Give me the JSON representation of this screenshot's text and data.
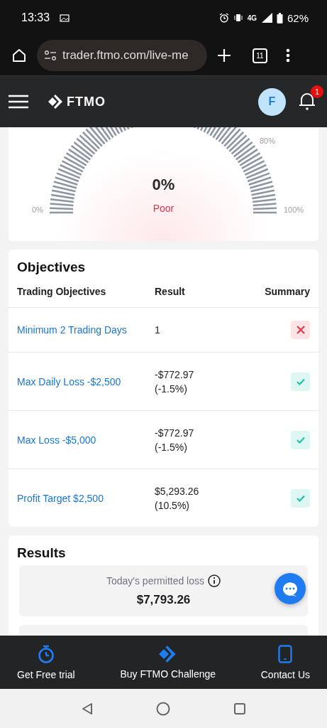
{
  "status_bar": {
    "time": "13:33",
    "network": "4G",
    "battery": "62%"
  },
  "browser": {
    "url": "trader.ftmo.com/live-me",
    "tab_count": "11"
  },
  "header": {
    "logo": "FTMO",
    "avatar": "F",
    "notifications": "1"
  },
  "gauge": {
    "value": "0%",
    "rating": "Poor",
    "labels": [
      "0%",
      "80%",
      "100%"
    ]
  },
  "objectives": {
    "title": "Objectives",
    "columns": [
      "Trading Objectives",
      "Result",
      "Summary"
    ],
    "rows": [
      {
        "name": "Minimum 2 Trading Days",
        "result": [
          "1"
        ],
        "passed": false
      },
      {
        "name": "Max Daily Loss -$2,500",
        "result": [
          "-$772.97",
          "(-1.5%)"
        ],
        "passed": true
      },
      {
        "name": "Max Loss -$5,000",
        "result": [
          "-$772.97",
          "(-1.5%)"
        ],
        "passed": true
      },
      {
        "name": "Profit Target $2,500",
        "result": [
          "$5,293.26",
          "(10.5%)"
        ],
        "passed": true
      }
    ]
  },
  "results": {
    "title": "Results",
    "items": [
      {
        "label": "Today's permitted loss",
        "value": "$7,793.26"
      }
    ]
  },
  "bottom_nav": [
    {
      "label": "Get Free trial"
    },
    {
      "label": "Buy FTMO Challenge"
    },
    {
      "label": "Contact Us"
    }
  ]
}
